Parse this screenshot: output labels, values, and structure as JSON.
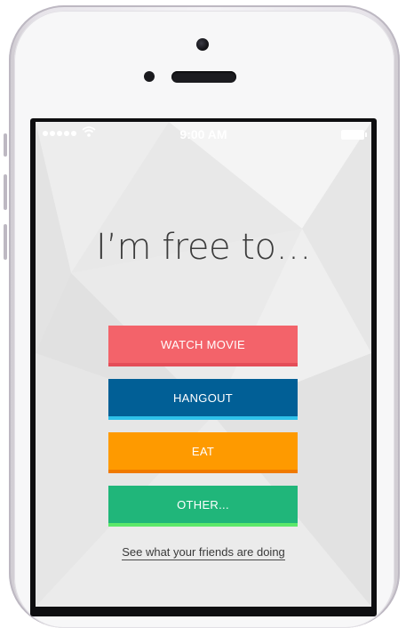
{
  "status_bar": {
    "time": "9:00 AM",
    "icons": [
      "signal-dots-icon",
      "wifi-icon",
      "battery-icon"
    ]
  },
  "main": {
    "headline": "I’m free to…",
    "buttons": [
      {
        "label": "WATCH MOVIE",
        "color": "#f3636a",
        "accent": "#e44d58"
      },
      {
        "label": "HANGOUT",
        "color": "#015f96",
        "accent": "#2ec1ea"
      },
      {
        "label": "EAT",
        "color": "#fe9a00",
        "accent": "#f07a00"
      },
      {
        "label": "OTHER...",
        "color": "#20b67a",
        "accent": "#5ce86a"
      }
    ],
    "friends_link": "See what your friends are doing"
  }
}
